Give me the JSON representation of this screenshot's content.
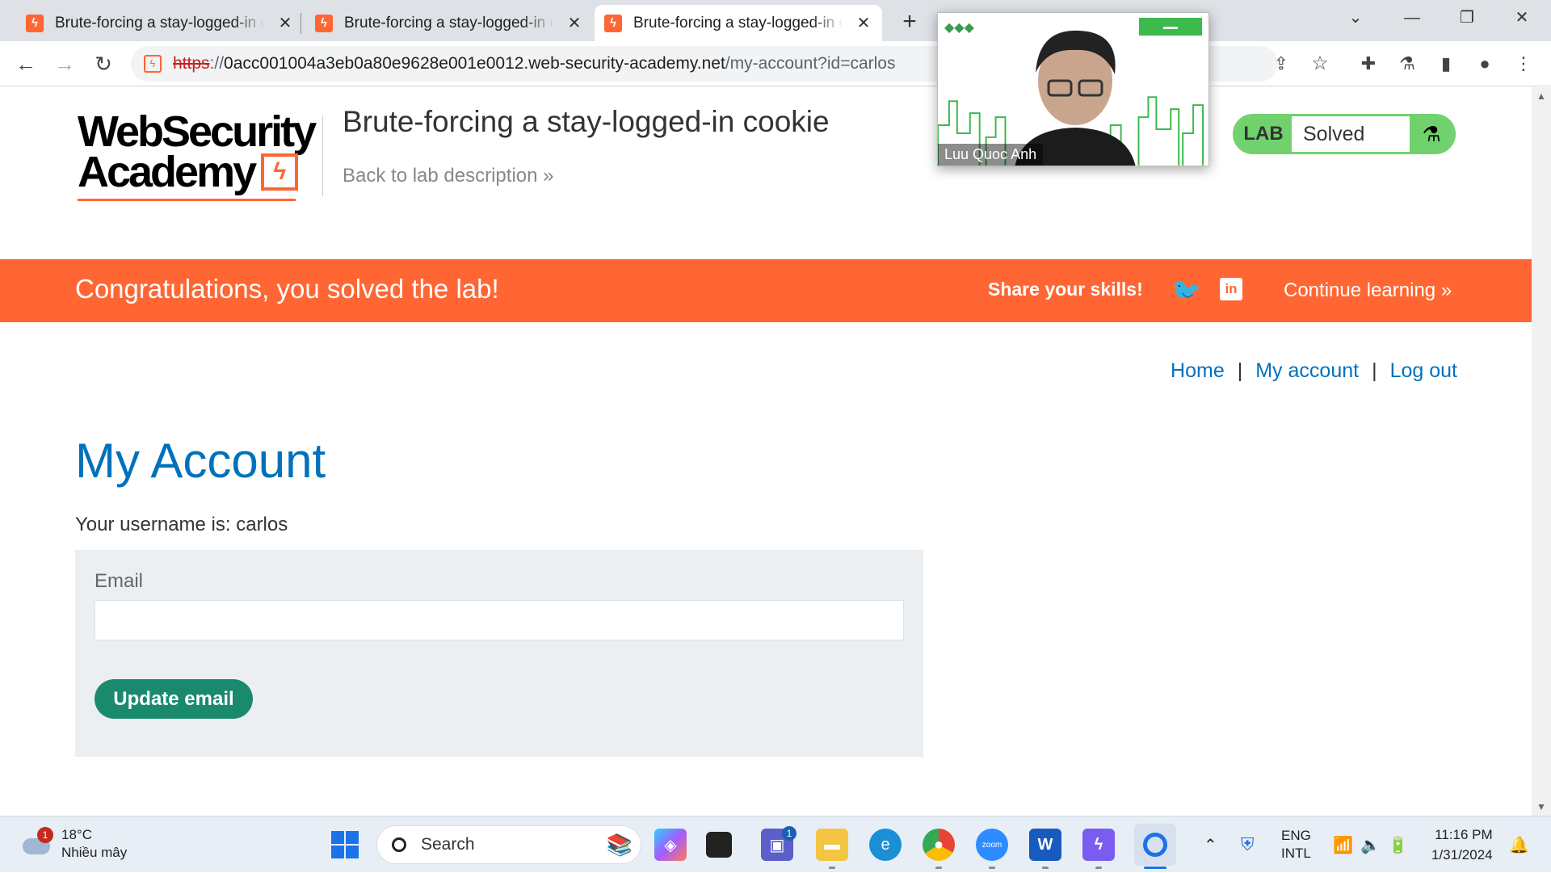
{
  "browser": {
    "tabs": [
      {
        "title": "Brute-forcing a stay-logged-in cookie",
        "active": false
      },
      {
        "title": "Brute-forcing a stay-logged-in cookie",
        "active": false
      },
      {
        "title": "Brute-forcing a stay-logged-in cookie",
        "active": true
      }
    ],
    "url": {
      "scheme": "https",
      "separator": "://",
      "host": "0acc001004a3eb0a80e9628e001e0012.web-security-academy.net",
      "path": "/my-account?id=carlos"
    }
  },
  "header": {
    "logo_line1": "WebSecurity",
    "logo_line2": "Academy",
    "lab_title": "Brute-forcing a stay-logged-in cookie",
    "back_link": "Back to lab description",
    "lab_badge": {
      "label": "LAB",
      "status": "Solved",
      "color": "#70d16d"
    }
  },
  "banner": {
    "message": "Congratulations, you solved the lab!",
    "share": "Share your skills!",
    "continue": "Continue learning",
    "color": "#ff6633"
  },
  "nav": {
    "home": "Home",
    "my_account": "My account",
    "log_out": "Log out",
    "separator": "|"
  },
  "account": {
    "heading": "My Account",
    "username_text": "Your username is: carlos",
    "email_label": "Email",
    "email_value": "",
    "update_button": "Update email"
  },
  "video": {
    "participant_name": "Luu Quoc Anh"
  },
  "taskbar": {
    "weather_temp": "18°C",
    "weather_desc": "Nhiều mây",
    "weather_badge": "1",
    "search_placeholder": "Search",
    "teams_badge": "1",
    "lang_line1": "ENG",
    "lang_line2": "INTL",
    "time": "11:16 PM",
    "date": "1/31/2024",
    "icons": [
      "windows-start-icon",
      "copilot-icon",
      "task-view-icon",
      "teams-icon",
      "file-explorer-icon",
      "edge-icon",
      "chrome-icon",
      "zoom-icon",
      "word-icon",
      "burp-icon",
      "chrome-active-icon"
    ]
  }
}
